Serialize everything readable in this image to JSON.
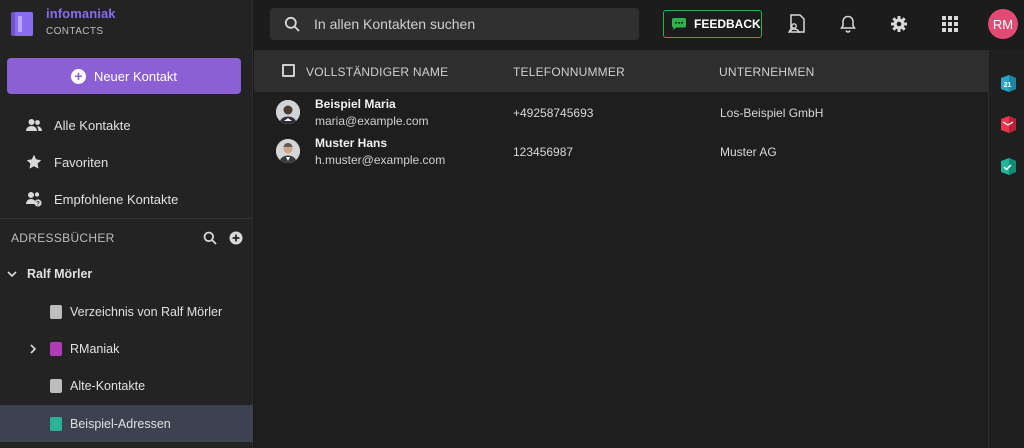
{
  "brand": {
    "name": "infomaniak",
    "product": "CONTACTS",
    "logo_icon": "book-logo-icon",
    "color": "#8a6cf0"
  },
  "sidebar": {
    "new_contact_label": "Neuer Kontakt",
    "nav": [
      {
        "label": "Alle Kontakte",
        "icon": "people-icon"
      },
      {
        "label": "Favoriten",
        "icon": "star-icon"
      },
      {
        "label": "Empfohlene Kontakte",
        "icon": "suggested-people-icon"
      }
    ],
    "address_books_title": "ADRESSBÜCHER",
    "owner": "Ralf Mörler",
    "books": [
      {
        "label": "Verzeichnis von Ralf Mörler",
        "color": "#bdbdbd"
      },
      {
        "label": "RManiak",
        "color": "#b03ab8"
      },
      {
        "label": "Alte-Kontakte",
        "color": "#bdbdbd"
      },
      {
        "label": "Beispiel-Adressen",
        "color": "#2bb39a",
        "active": true
      }
    ]
  },
  "topbar": {
    "search_placeholder": "In allen Kontakten suchen",
    "feedback_label": "FEEDBACK",
    "avatar_initials": "RM",
    "avatar_color": "#e04a73"
  },
  "table": {
    "columns": [
      "VOLLSTÄNDIGER NAME",
      "TELEFONNUMMER",
      "UNTERNEHMEN"
    ],
    "rows": [
      {
        "name": "Beispiel Maria",
        "email": "maria@example.com",
        "phone": "+49258745693",
        "company": "Los-Beispiel GmbH"
      },
      {
        "name": "Muster Hans",
        "email": "h.muster@example.com",
        "phone": "123456987",
        "company": "Muster AG"
      }
    ]
  },
  "rail": {
    "apps": [
      {
        "icon": "calendar-app-icon",
        "text": "21",
        "color": "#29a7c9"
      },
      {
        "icon": "mail-app-icon",
        "color": "#e8384f"
      },
      {
        "icon": "tasks-app-icon",
        "color": "#22b39a"
      }
    ]
  }
}
